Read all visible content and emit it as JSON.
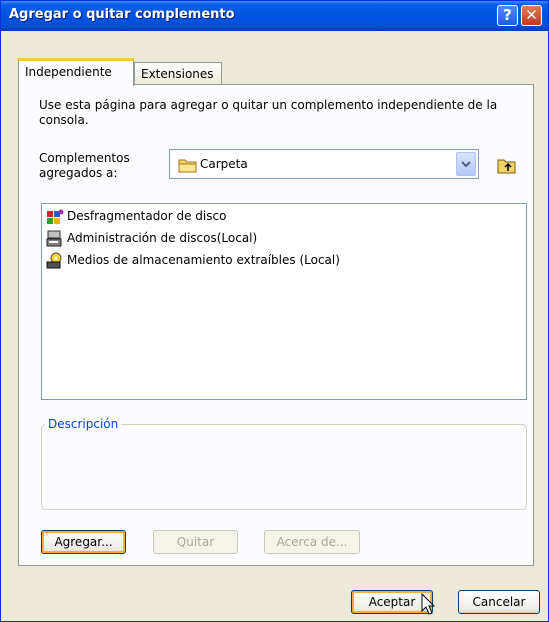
{
  "window": {
    "title": "Agregar o quitar complemento"
  },
  "titlebar": {
    "help_label": "?",
    "close_label": "✕"
  },
  "tabs": [
    {
      "label": "Independiente"
    },
    {
      "label": "Extensiones"
    }
  ],
  "page": {
    "intro": "Use esta página para agregar o quitar un complemento independiente de la consola.",
    "added_label": "Complementos agregados a:",
    "combo_value": "Carpeta",
    "items": [
      {
        "label": "Desfragmentador de disco",
        "icon": "defrag-icon"
      },
      {
        "label": "Administración de discos(Local)",
        "icon": "disk-management-icon"
      },
      {
        "label": "Medios de almacenamiento extraíbles (Local)",
        "icon": "removable-storage-icon"
      }
    ],
    "description_label": "Descripción",
    "add_label": "Agregar...",
    "remove_label": "Quitar",
    "about_label": "Acerca de..."
  },
  "footer": {
    "ok_label": "Aceptar",
    "cancel_label": "Cancelar"
  }
}
